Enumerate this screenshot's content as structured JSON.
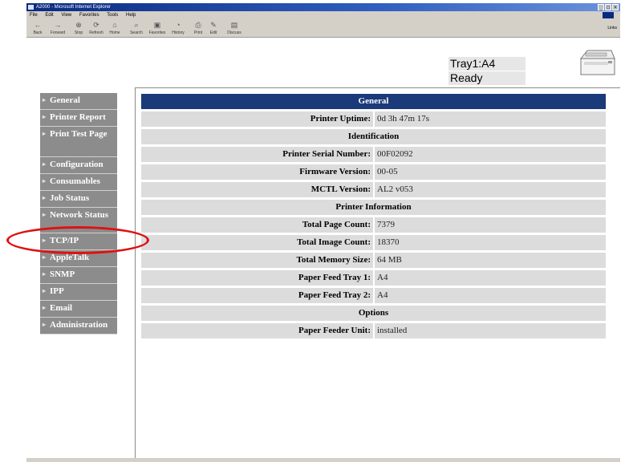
{
  "window": {
    "title": "A2000 - Microsoft Internet Explorer",
    "menu": [
      "File",
      "Edit",
      "View",
      "Favorites",
      "Tools",
      "Help"
    ],
    "toolbar": [
      {
        "label": "Back",
        "icon": "back-arrow-icon"
      },
      {
        "label": "Forward",
        "icon": "forward-arrow-icon"
      },
      {
        "label": "Stop",
        "icon": "stop-icon"
      },
      {
        "label": "Refresh",
        "icon": "refresh-icon"
      },
      {
        "label": "Home",
        "icon": "home-icon"
      },
      {
        "label": "Search",
        "icon": "search-icon"
      },
      {
        "label": "Favorites",
        "icon": "favorites-icon"
      },
      {
        "label": "History",
        "icon": "history-icon"
      },
      {
        "label": "Print",
        "icon": "print-icon"
      },
      {
        "label": "Edit",
        "icon": "edit-icon"
      },
      {
        "label": "Discuss",
        "icon": "discuss-icon"
      }
    ],
    "links_label": "Links"
  },
  "status": {
    "tray": "Tray1:A4",
    "state": "Ready"
  },
  "sidebar": {
    "items": [
      {
        "label": "General"
      },
      {
        "label": "Printer Report"
      },
      {
        "label": "Print Test Page"
      },
      {
        "label": "Configuration"
      },
      {
        "label": "Consumables"
      },
      {
        "label": "Job Status"
      },
      {
        "label": "Network Status"
      },
      {
        "label": "TCP/IP"
      },
      {
        "label": "AppleTalk"
      },
      {
        "label": "SNMP"
      },
      {
        "label": "IPP"
      },
      {
        "label": "Email"
      },
      {
        "label": "Administration"
      }
    ]
  },
  "table": {
    "title": "General",
    "uptime": {
      "label": "Printer Uptime:",
      "value": "0d 3h 47m 17s"
    },
    "identification": {
      "heading": "Identification",
      "rows": [
        {
          "label": "Printer Serial Number:",
          "value": "00F02092"
        },
        {
          "label": "Firmware Version:",
          "value": "00-05"
        },
        {
          "label": "MCTL Version:",
          "value": "AL2 v053"
        }
      ]
    },
    "printer_info": {
      "heading": "Printer Information",
      "rows": [
        {
          "label": "Total Page Count:",
          "value": "7379"
        },
        {
          "label": "Total Image Count:",
          "value": "18370"
        },
        {
          "label": "Total Memory Size:",
          "value": "64 MB"
        },
        {
          "label": "Paper Feed Tray 1:",
          "value": "A4"
        },
        {
          "label": "Paper Feed Tray 2:",
          "value": "A4"
        }
      ]
    },
    "options": {
      "heading": "Options",
      "rows": [
        {
          "label": "Paper Feeder Unit:",
          "value": "installed"
        }
      ]
    }
  },
  "colors": {
    "title_bar": "#1a3a7a",
    "row_bg": "#dcdcdc",
    "sidebar_bg": "#8c8c8c",
    "highlight": "#e01010"
  }
}
